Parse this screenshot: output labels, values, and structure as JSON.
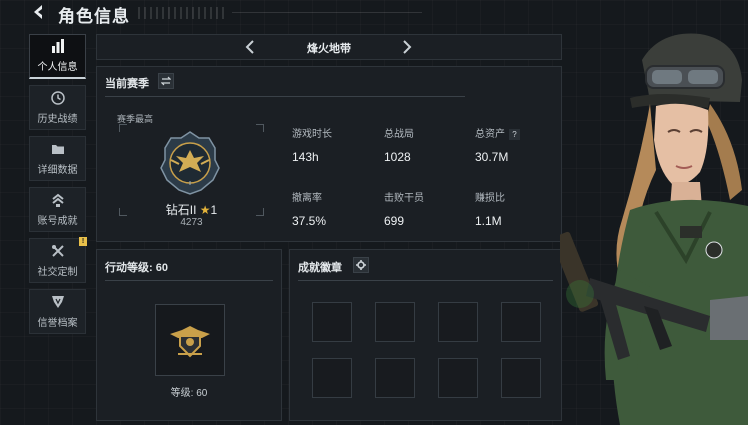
{
  "header": {
    "title": "角色信息"
  },
  "sidebar": {
    "items": [
      {
        "label": "个人信息",
        "active": true
      },
      {
        "label": "历史战绩"
      },
      {
        "label": "详细数据"
      },
      {
        "label": "账号成就"
      },
      {
        "label": "社交定制",
        "badge": "!"
      },
      {
        "label": "信誉档案"
      }
    ]
  },
  "map": {
    "name": "烽火地带"
  },
  "season": {
    "title": "当前赛季",
    "best_label": "赛季最高",
    "rank_tier": "钻石II",
    "rank_stars": "1",
    "rank_score": "4273",
    "stats": [
      {
        "label": "游戏时长",
        "value": "143h"
      },
      {
        "label": "总战局",
        "value": "1028"
      },
      {
        "label": "总资产",
        "value": "30.7M",
        "help": "?"
      },
      {
        "label": "撤离率",
        "value": "37.5%"
      },
      {
        "label": "击败干员",
        "value": "699"
      },
      {
        "label": "赚损比",
        "value": "1.1M"
      }
    ]
  },
  "level": {
    "title": "行动等级: 60",
    "text": "等级: 60"
  },
  "achievements": {
    "title": "成就徽章"
  },
  "colors": {
    "accent_star": "#e3b33a",
    "notif": "#e9c04a",
    "badge_gold": "#c9a04a"
  }
}
